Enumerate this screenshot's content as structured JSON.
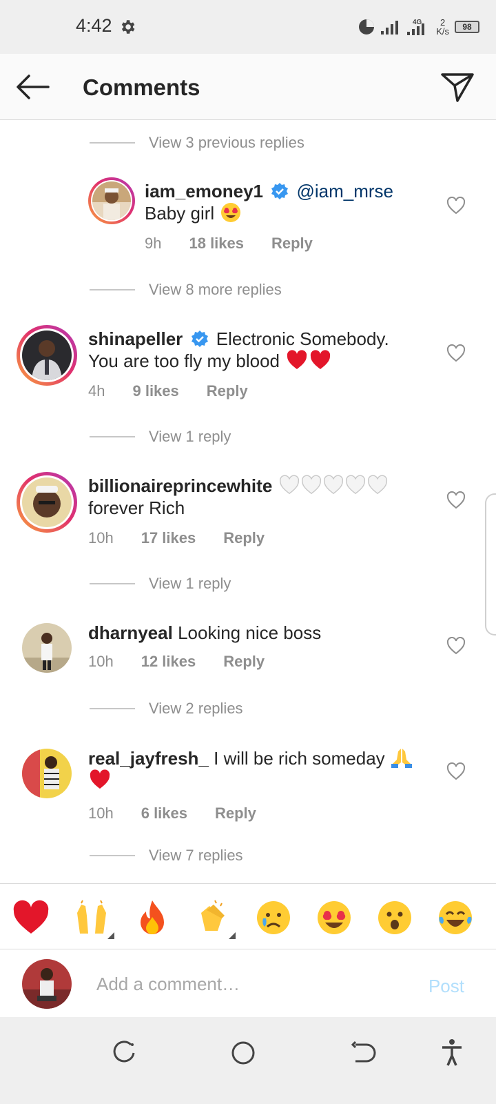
{
  "status_bar": {
    "time": "4:42",
    "network_speed": "2",
    "network_unit": "K/s",
    "network_type": "4G",
    "battery": "98"
  },
  "header": {
    "title": "Comments"
  },
  "view_links": [
    "View 3 previous replies",
    "View 8 more replies",
    "View 1 reply",
    "View 1 reply",
    "View 2 replies",
    "View 7 replies"
  ],
  "comments": [
    {
      "username": "iam_emoney1",
      "verified": true,
      "mention": "@iam_mrse",
      "text": "Baby girl",
      "emoji": "heart-eyes",
      "time": "9h",
      "likes": "18 likes",
      "reply": "Reply"
    },
    {
      "username": "shinapeller",
      "verified": true,
      "text": "Electronic Somebody. You are too fly my blood",
      "emoji": "red-hearts",
      "time": "4h",
      "likes": "9 likes",
      "reply": "Reply"
    },
    {
      "username": "billionaireprincewhite",
      "verified": false,
      "text": "forever Rich",
      "emoji": "white-hearts",
      "time": "10h",
      "likes": "17 likes",
      "reply": "Reply"
    },
    {
      "username": "dharnyeal",
      "verified": false,
      "text": "Looking nice boss",
      "time": "10h",
      "likes": "12 likes",
      "reply": "Reply"
    },
    {
      "username": "real_jayfresh_",
      "verified": false,
      "text": "I will be rich someday",
      "emoji": "pray-heart",
      "time": "10h",
      "likes": "6 likes",
      "reply": "Reply"
    }
  ],
  "emoji_bar": [
    "heart",
    "raised-hands",
    "fire",
    "clapping-hands",
    "crying-face",
    "heart-eyes",
    "astonished",
    "tears-of-joy"
  ],
  "comment_input": {
    "placeholder": "Add a comment…",
    "post_label": "Post"
  },
  "colors": {
    "accent": "#3897f0",
    "verified_blue": "#3897f0",
    "post_disabled": "#b2dffc",
    "muted_text": "#8e8e8e"
  }
}
